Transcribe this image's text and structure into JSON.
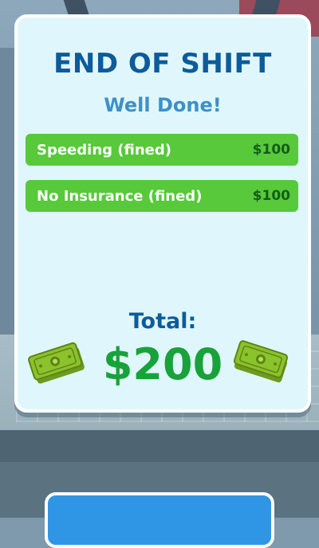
{
  "panel": {
    "title": "END OF SHIFT",
    "subtitle": "Well Done!",
    "fines": [
      {
        "label": "Speeding (fined)",
        "amount": "$100"
      },
      {
        "label": "No Insurance (fined)",
        "amount": "$100"
      }
    ],
    "total_label": "Total:",
    "total_value": "$200"
  },
  "icons": {
    "cash_left": "cash-stack-icon",
    "cash_right": "cash-stack-icon"
  },
  "colors": {
    "panel_bg": "#dff7fc",
    "title": "#0e5b9a",
    "subtitle": "#3d90c8",
    "fine_row": "#57c93a",
    "fine_amount": "#155c1a",
    "total_value": "#18a23a",
    "button": "#2f96e6"
  },
  "claim_button": {
    "label": ""
  }
}
